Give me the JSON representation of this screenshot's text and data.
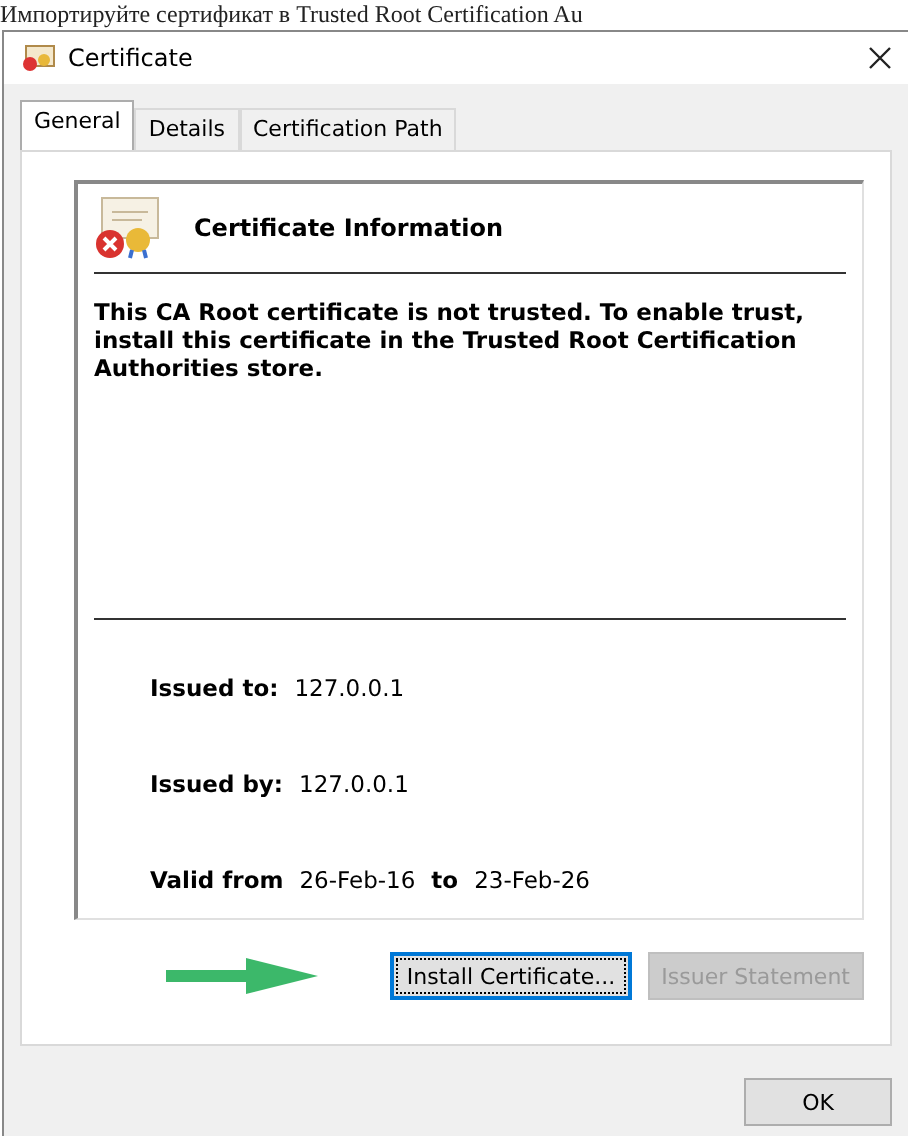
{
  "caption": "Импортируйте сертификат в Trusted Root Certification Au",
  "window": {
    "title": "Certificate"
  },
  "tabs": [
    {
      "label": "General",
      "selected": true
    },
    {
      "label": "Details",
      "selected": false
    },
    {
      "label": "Certification Path",
      "selected": false
    }
  ],
  "info": {
    "heading": "Certificate Information",
    "message": "This CA Root certificate is not trusted. To enable trust, install this certificate in the Trusted Root Certification Authorities store."
  },
  "fields": [
    {
      "label": "Issued to:",
      "value": "127.0.0.1"
    },
    {
      "label": "Issued by:",
      "value": "127.0.0.1"
    }
  ],
  "validity": {
    "from_label": "Valid from",
    "from": "26-Feb-16",
    "to_label": "to",
    "to": "23-Feb-26"
  },
  "buttons": [
    {
      "label": "Install Certificate...",
      "disabled": false,
      "focused": true
    },
    {
      "label": "Issuer Statement",
      "disabled": true,
      "focused": false
    }
  ],
  "footer_buttons": [
    {
      "label": "OK"
    }
  ]
}
